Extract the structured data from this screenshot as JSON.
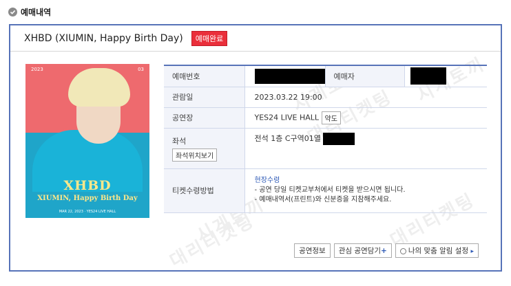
{
  "section": {
    "title": "예매내역"
  },
  "performance": {
    "title": "XHBD  (XIUMIN, Happy Birth Day)",
    "status_badge": "예매완료"
  },
  "poster": {
    "year": "2023",
    "corner": "03",
    "logo": "XHBD",
    "subtitle": "XIUMIN, Happy Birth Day",
    "footer": "MAR 22, 2023 · YES24 LIVE HALL"
  },
  "details": {
    "booking_no_label": "예매번호",
    "booker_label": "예매자",
    "date_label": "관람일",
    "date_value": "2023.03.22 19:00",
    "venue_label": "공연장",
    "venue_value": "YES24 LIVE HALL",
    "map_button": "약도",
    "seat_label": "좌석",
    "seat_view_button": "좌석위치보기",
    "seat_value": "전석 1층 C구역01열",
    "ticket_method_label": "티켓수령방법",
    "ticket_method_link": "현장수령",
    "ticket_note_1": "- 공연 당일 티켓교부처에서 티켓을 받으시면 됩니다.",
    "ticket_note_2": "- 예매내역서(프린트)와 신분증을 지참해주세요."
  },
  "actions": {
    "performance_info": "공연정보",
    "add_interest": "관심 공연담기",
    "alarm_setting": "나의 맞춤 알림 설정"
  },
  "watermark": {
    "line1": "시게토끼",
    "line2": "대리티켓팅"
  }
}
